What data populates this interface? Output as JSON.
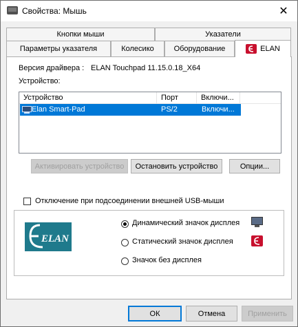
{
  "window": {
    "title": "Свойства: Мышь",
    "close_glyph": "✕"
  },
  "tabs": {
    "top_row": [
      "Кнопки мыши",
      "Указатели"
    ],
    "bottom_row": [
      "Параметры указателя",
      "Колесико",
      "Оборудование",
      "ELAN"
    ],
    "active": "ELAN"
  },
  "elan": {
    "driver_label": "Версия драйвера :",
    "driver_value": "ELAN Touchpad 11.15.0.18_X64",
    "device_label": "Устройство:",
    "columns": [
      "Устройство",
      "Порт",
      "Включи..."
    ],
    "device_row": {
      "name": "Elan Smart-Pad",
      "port": "PS/2",
      "enabled": "Включи..."
    },
    "buttons": {
      "activate": "Активировать устройство",
      "stop": "Остановить устройство",
      "options": "Опции..."
    },
    "usb_checkbox_label": "Отключение при подсоединении внешней USB-мыши",
    "usb_checked": false,
    "logo_text": "ELAN",
    "display_options": [
      {
        "label": "Динамический значок дисплея",
        "selected": true,
        "icon": "monitor-icon"
      },
      {
        "label": "Статический значок дисплея",
        "selected": false,
        "icon": "elan-e-icon"
      },
      {
        "label": "Значок без дисплея",
        "selected": false,
        "icon": ""
      }
    ]
  },
  "footer": {
    "ok": "ОК",
    "cancel": "Отмена",
    "apply": "Применить"
  },
  "colors": {
    "selection": "#0078d7",
    "elan_logo": "#1f7a8c",
    "elan_red": "#c8102e"
  }
}
